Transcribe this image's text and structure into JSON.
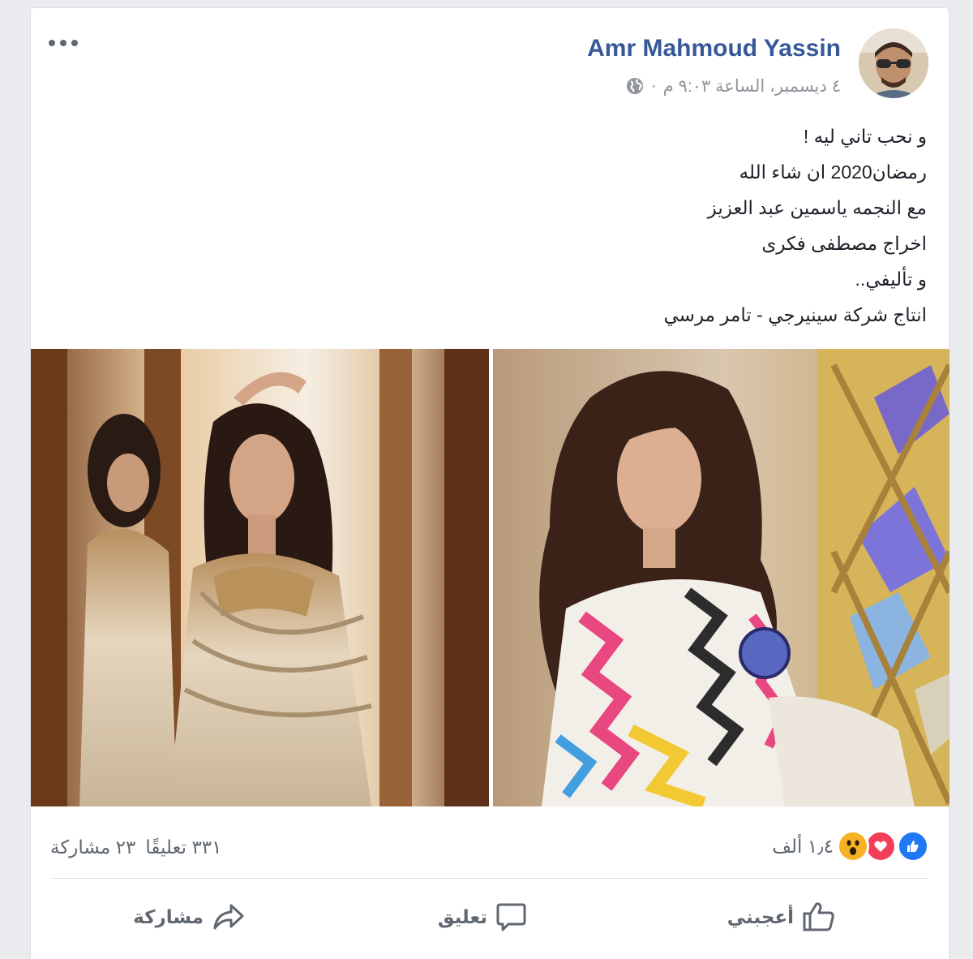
{
  "post": {
    "author": "Amr Mahmoud Yassin",
    "timestamp": "٤ ديسمبر، الساعة ٩:٠٣ م",
    "separator": "·",
    "privacy_icon": "globe-icon",
    "text_lines": [
      "و نحب تاني ليه !",
      "رمضان2020 ان شاء الله",
      "مع النجمه ياسمين عبد العزيز",
      "اخراج مصطفى فكرى",
      "و تأليفي..",
      "انتاج شركة سينيرجي - تامر مرسي"
    ]
  },
  "reactions": {
    "icons": [
      "like-icon",
      "love-icon",
      "wow-icon"
    ],
    "count": "١٫٤ ألف",
    "colors": {
      "like": "#2078f4",
      "love": "#f33e58",
      "wow": "#f7b125"
    }
  },
  "counts": {
    "comments": "٣٣١ تعليقًا",
    "shares": "٢٣ مشاركة"
  },
  "actions": {
    "like": "أعجبني",
    "comment": "تعليق",
    "share": "مشاركة"
  },
  "theme": {
    "link_color": "#365899",
    "muted_color": "#90949c",
    "text_color": "#1d2129"
  }
}
